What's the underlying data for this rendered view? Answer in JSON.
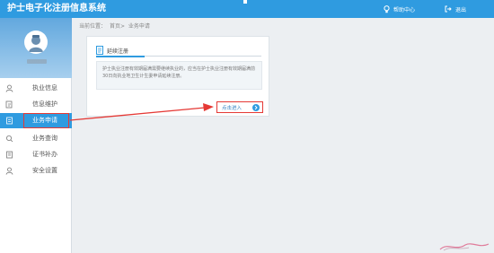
{
  "header": {
    "title": "护士电子化注册信息系统",
    "help_label": "帮助中心",
    "exit_label": "退出"
  },
  "sidebar": {
    "items": [
      {
        "label": "执业信息",
        "icon": "person-icon"
      },
      {
        "label": "信息维护",
        "icon": "edit-icon"
      },
      {
        "label": "业务申请",
        "icon": "document-icon",
        "active": true
      },
      {
        "label": "业务查询",
        "icon": "search-icon"
      },
      {
        "label": "证书补办",
        "icon": "certificate-icon"
      },
      {
        "label": "安全设置",
        "icon": "user-lock-icon"
      }
    ]
  },
  "breadcrumb": {
    "prefix": "当前位置：",
    "home": "首页>",
    "current": "业务申请"
  },
  "panel": {
    "title": "延续注册",
    "description": "护士执业注册有效期届满需要继续执业的，应当在护士执业注册有效期届满前30日向执业地卫生计生委申请延续注册。",
    "enter_label": "点击进入"
  },
  "colors": {
    "header": "#2f9be0",
    "accent_red": "#e53935"
  }
}
